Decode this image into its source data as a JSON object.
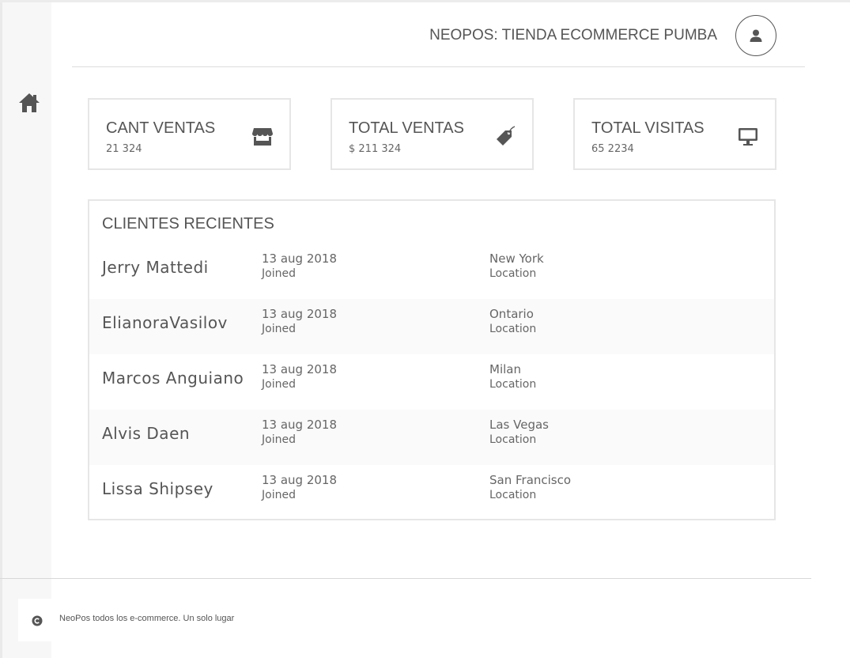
{
  "header": {
    "title": "NEOPOS: TIENDA ECOMMERCE PUMBA",
    "avatar_icon": "user-icon"
  },
  "sidebar": {
    "home_icon": "home-icon"
  },
  "stats": [
    {
      "title": "CANT VENTAS",
      "value": "21 324",
      "icon": "store-icon"
    },
    {
      "title": "TOTAL VENTAS",
      "value": "$ 211 324",
      "icon": "tag-icon"
    },
    {
      "title": "TOTAL VISITAS",
      "value": "65 2234",
      "icon": "monitor-icon"
    }
  ],
  "clients": {
    "title": "CLIENTES RECIENTES",
    "rows": [
      {
        "name": "Jerry Mattedi",
        "date": "13 aug 2018",
        "date_label": "Joined",
        "location": "New York",
        "location_label": "Location"
      },
      {
        "name": "ElianoraVasilov",
        "date": "13 aug 2018",
        "date_label": "Joined",
        "location": "Ontario",
        "location_label": "Location"
      },
      {
        "name": "Marcos Anguiano",
        "date": "13 aug 2018",
        "date_label": "Joined",
        "location": "Milan",
        "location_label": "Location"
      },
      {
        "name": "Alvis Daen",
        "date": "13 aug 2018",
        "date_label": "Joined",
        "location": "Las Vegas",
        "location_label": "Location"
      },
      {
        "name": "Lissa Shipsey",
        "date": "13 aug 2018",
        "date_label": "Joined",
        "location": "San Francisco",
        "location_label": "Location"
      }
    ]
  },
  "footer": {
    "text": "NeoPos todos los e-commerce. Un solo lugar",
    "icon": "copyright-icon"
  }
}
